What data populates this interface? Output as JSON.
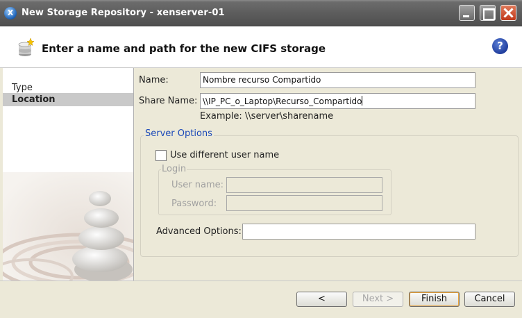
{
  "window": {
    "title": "New Storage Repository - xenserver-01",
    "app_icon_glyph": "X"
  },
  "header": {
    "title": "Enter a name and path for the new CIFS storage",
    "help_glyph": "?"
  },
  "sidebar": {
    "steps": [
      {
        "label": "Type",
        "selected": false
      },
      {
        "label": "Location",
        "selected": true
      }
    ]
  },
  "form": {
    "name_label": "Name:",
    "name_value": "Nombre recurso Compartido",
    "share_label": "Share Name:",
    "share_value": "\\\\IP_PC_o_Laptop\\Recurso_Compartido",
    "example_text": "Example: \\\\server\\sharename",
    "server_options_title": "Server Options",
    "use_different_user_label": "Use different user name",
    "use_different_user_checked": false,
    "login_title": "Login",
    "username_label": "User name:",
    "username_value": "",
    "password_label": "Password:",
    "password_value": "",
    "advanced_label": "Advanced Options:",
    "advanced_value": ""
  },
  "footer": {
    "back_label": "<",
    "next_label": "Next >",
    "finish_label": "Finish",
    "cancel_label": "Cancel"
  },
  "colors": {
    "accent": "#1b49b8",
    "window_bg": "#ece9d8",
    "titlebar": "#5d5d5d"
  }
}
